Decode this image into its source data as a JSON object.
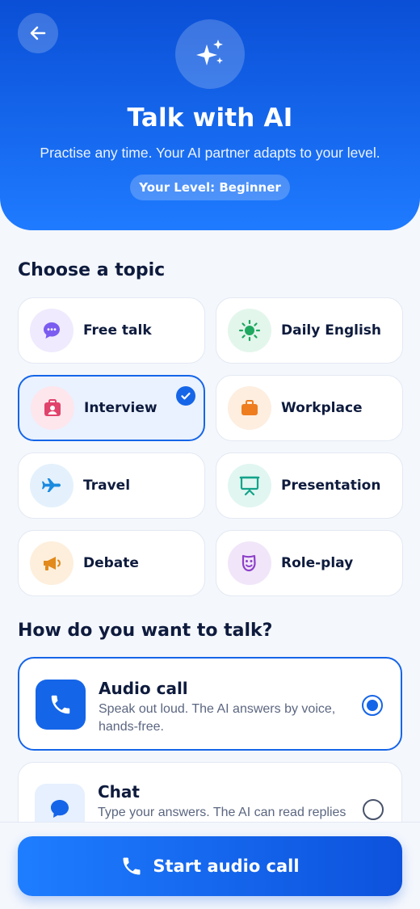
{
  "header": {
    "title": "Talk with AI",
    "subtitle": "Practise any time. Your AI partner adapts to your level.",
    "level_badge": "Your Level: Beginner"
  },
  "topics": {
    "heading": "Choose a topic",
    "items": [
      {
        "label": "Free talk",
        "icon": "chat-bubble-icon",
        "selected": false
      },
      {
        "label": "Daily English",
        "icon": "sun-icon",
        "selected": false
      },
      {
        "label": "Interview",
        "icon": "badge-icon",
        "selected": true
      },
      {
        "label": "Workplace",
        "icon": "briefcase-icon",
        "selected": false
      },
      {
        "label": "Travel",
        "icon": "airplane-icon",
        "selected": false
      },
      {
        "label": "Presentation",
        "icon": "easel-icon",
        "selected": false
      },
      {
        "label": "Debate",
        "icon": "megaphone-icon",
        "selected": false
      },
      {
        "label": "Role-play",
        "icon": "theater-mask-icon",
        "selected": false
      }
    ]
  },
  "modes": {
    "heading": "How do you want to talk?",
    "items": [
      {
        "title": "Audio call",
        "description": "Speak out loud. The AI answers by voice, hands-free.",
        "icon": "phone-icon",
        "selected": true
      },
      {
        "title": "Chat",
        "description": "Type your answers. The AI can read replies",
        "icon": "chat-icon",
        "selected": false
      }
    ]
  },
  "cta": {
    "label": "Start audio call",
    "icon": "phone-icon"
  },
  "colors": {
    "primary": "#1565e8",
    "header_top": "#0a4fd6",
    "header_bottom": "#1f7bff",
    "text_dark": "#0e1b3d"
  }
}
